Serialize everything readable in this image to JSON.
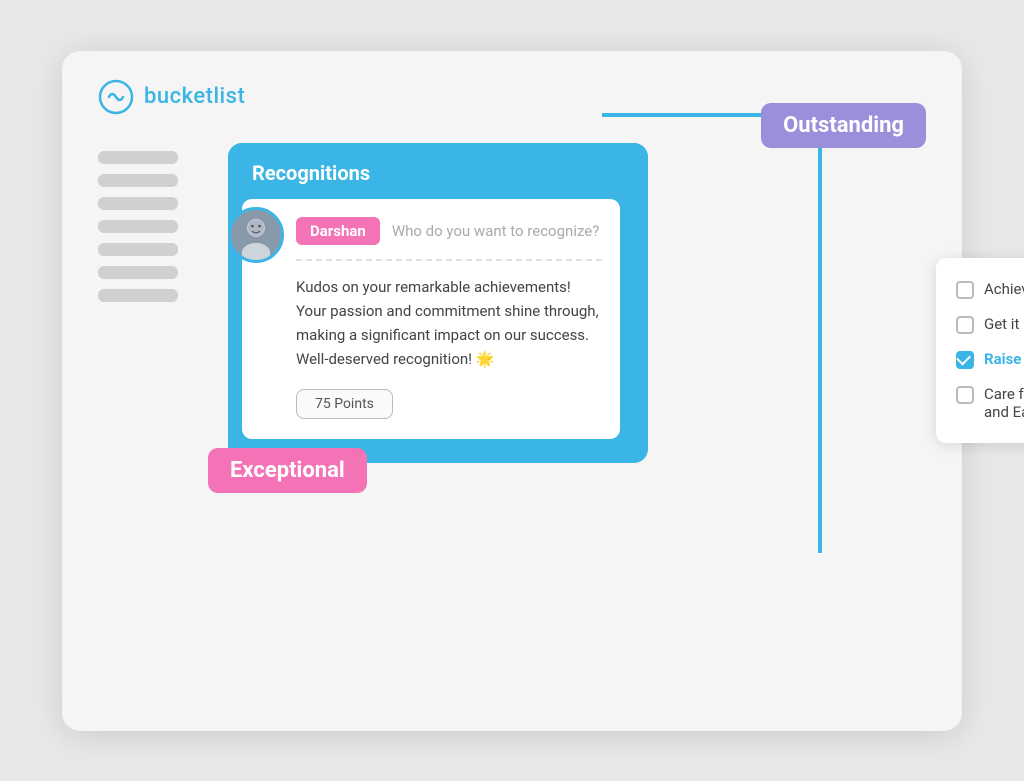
{
  "logo": {
    "text": "bucketlist"
  },
  "header": {
    "outstanding_label": "Outstanding",
    "exceptional_label": "Exceptional"
  },
  "recognitions_card": {
    "title": "Recognitions",
    "name_badge": "Darshan",
    "recognize_placeholder": "Who do you want to recognize?",
    "kudos_text": "Kudos on your remarkable achievements! Your passion and commitment shine through, making a significant impact on our success. Well-deserved recognition! 🌟",
    "points": "75 Points"
  },
  "options": [
    {
      "label": "Achieve Life Goals",
      "checked": false
    },
    {
      "label": "Get it Done",
      "checked": false
    },
    {
      "label": "Raise the Bar",
      "checked": true
    },
    {
      "label": "Care for Customers\nand Each Other",
      "checked": false
    }
  ],
  "sidebar_bars": [
    1,
    2,
    3,
    4,
    5,
    6,
    7
  ]
}
